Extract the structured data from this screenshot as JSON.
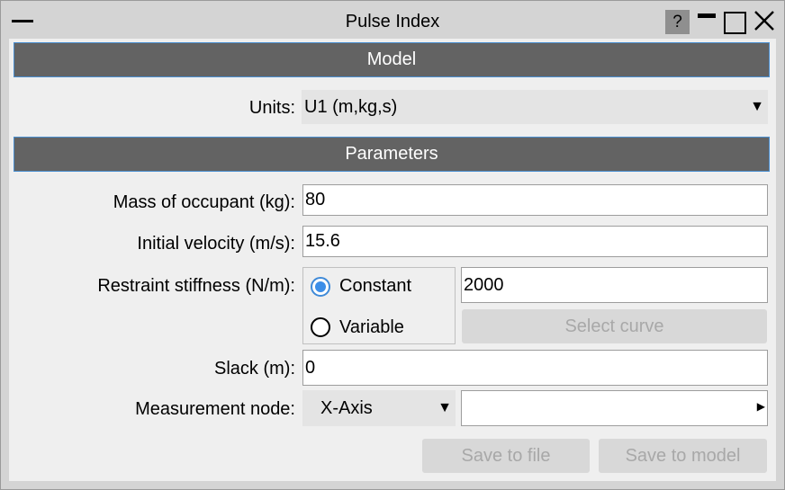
{
  "window": {
    "title": "Pulse Index",
    "help_label": "?"
  },
  "sections": {
    "model": "Model",
    "parameters": "Parameters"
  },
  "units": {
    "label": "Units:",
    "value": "U1 (m,kg,s)"
  },
  "mass": {
    "label": "Mass of occupant (kg):",
    "value": "80"
  },
  "velocity": {
    "label": "Initial velocity (m/s):",
    "value": "15.6"
  },
  "stiffness": {
    "label": "Restraint stiffness (N/m):",
    "constant_label": "Constant",
    "variable_label": "Variable",
    "selected": "Constant",
    "value": "2000",
    "select_curve_label": "Select curve"
  },
  "slack": {
    "label": "Slack (m):",
    "value": "0"
  },
  "measurement": {
    "label": "Measurement node:",
    "axis_value": "X-Axis",
    "node_value": ""
  },
  "actions": {
    "save_file": "Save to file",
    "save_model": "Save to model"
  },
  "colors": {
    "header_bg": "#636363",
    "accent": "#3c8ee8",
    "panel_bg": "#efefef"
  }
}
